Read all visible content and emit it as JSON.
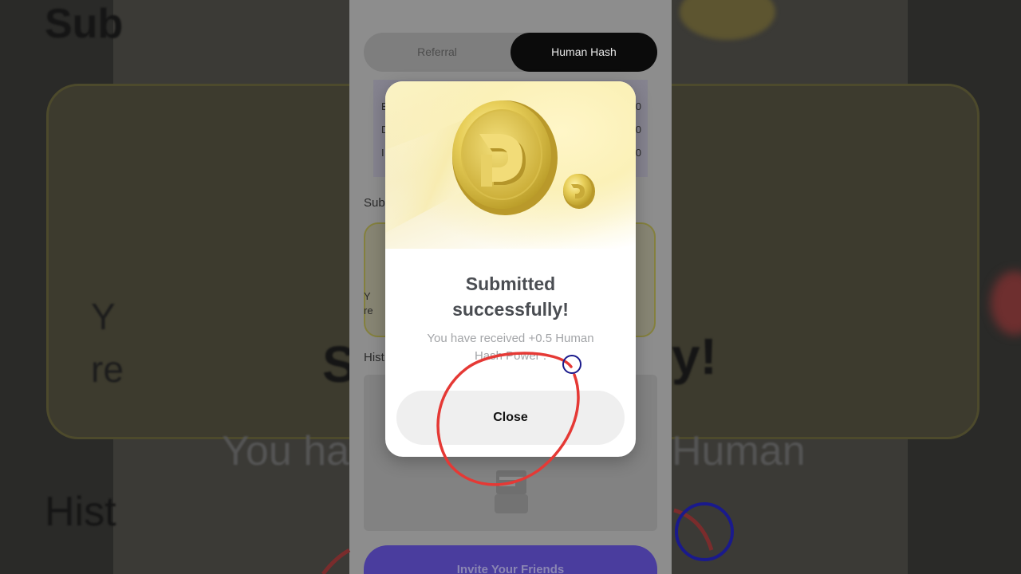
{
  "background": {
    "left_title_fragment": "Sub",
    "left_text_fragment_1": "Y",
    "left_text_fragment_2": "re",
    "left_big_title": "S",
    "left_subtitle": "You hav",
    "left_hist": "Hist",
    "right_big_title": "y!",
    "right_subtitle": "Human"
  },
  "tabs": {
    "referral": "Referral",
    "human_hash": "Human Hash",
    "active": "Human Hash"
  },
  "stats": {
    "rows": [
      {
        "label": "E",
        "value": "0"
      },
      {
        "label": "D",
        "value": "0"
      },
      {
        "label": "I",
        "value": "0"
      }
    ]
  },
  "sections": {
    "submit": "Sub",
    "task_text_1": "Y",
    "task_text_2": "re",
    "history": "Hist"
  },
  "invite": {
    "label": "Invite Your Friends"
  },
  "modal": {
    "title_line1": "Submitted",
    "title_line2": "successfully!",
    "desc_line1": "You have received +0.5 Human",
    "desc_line2": "Hash Power .",
    "close_label": "Close"
  },
  "colors": {
    "tab_active_bg": "#0b0b0b",
    "invite_bg": "#4a3d9e",
    "annotation_red": "#e53935",
    "annotation_blue": "#1a1a8c"
  }
}
